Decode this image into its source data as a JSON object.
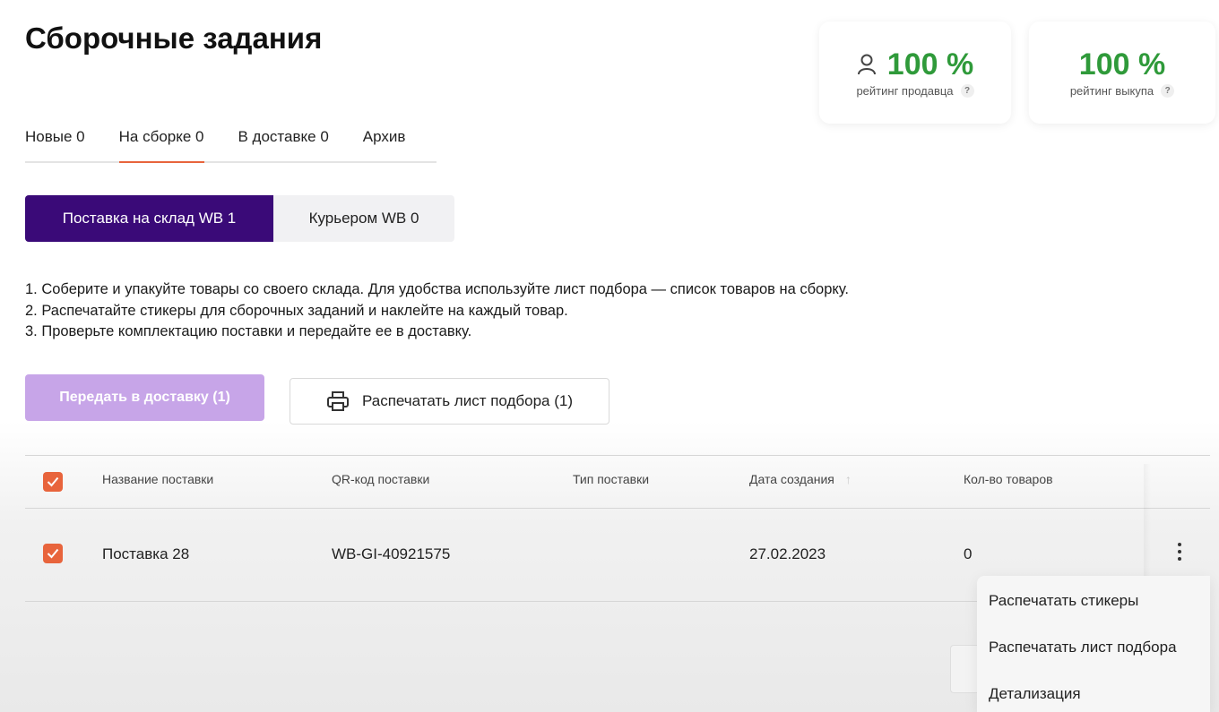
{
  "page": {
    "title": "Сборочные задания"
  },
  "ratings": [
    {
      "value": "100 %",
      "label": "рейтинг продавца",
      "icon": "person-icon",
      "color": "#2f9a3a"
    },
    {
      "value": "100 %",
      "label": "рейтинг выкупа",
      "color": "#2f9a3a"
    }
  ],
  "tabs": [
    {
      "label": "Новые 0",
      "active": false
    },
    {
      "label": "На сборке 0",
      "active": true
    },
    {
      "label": "В доставке 0",
      "active": false
    },
    {
      "label": "Архив",
      "active": false
    }
  ],
  "segment": {
    "active": "Поставка на склад WB 1",
    "inactive": "Курьером WB 0"
  },
  "instructions": [
    "1. Соберите и упакуйте товары со своего склада. Для удобства используйте лист подбора — список товаров на сборку.",
    "2. Распечатайте стикеры для сборочных заданий и наклейте на каждый товар.",
    "3. Проверьте комплектацию поставки и передайте ее в доставку."
  ],
  "actions": {
    "send_label": "Передать в доставку (1)",
    "print_label": "Распечатать лист подбора (1)"
  },
  "table": {
    "headers": [
      "Название поставки",
      "QR-код поставки",
      "Тип поставки",
      "Дата создания",
      "Кол-во товаров"
    ],
    "rows": [
      {
        "name": "Поставка 28",
        "qr": "WB-GI-40921575",
        "type": "",
        "date": "27.02.2023",
        "count": "0",
        "checked": true
      }
    ]
  },
  "menu": {
    "items": [
      "Распечатать стикеры",
      "Распечатать лист подбора",
      "Детализация"
    ]
  },
  "colors": {
    "accent": "#e8643c",
    "primary": "#3a0a78",
    "primary_disabled": "#c7a5e8",
    "rating": "#2f9a3a"
  }
}
